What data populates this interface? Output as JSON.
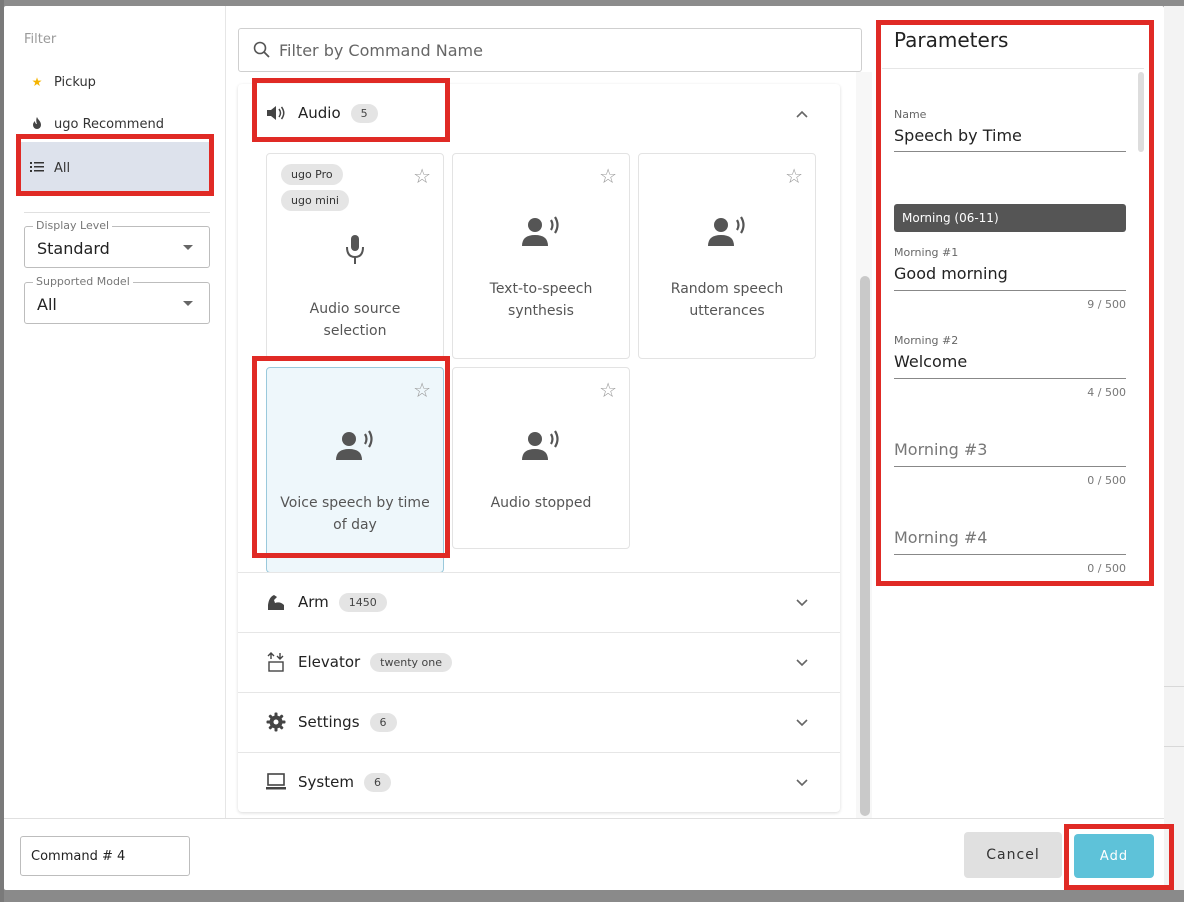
{
  "filter": {
    "title": "Filter",
    "items": [
      {
        "label": "Pickup",
        "icon": "star-icon"
      },
      {
        "label": "ugo Recommend",
        "icon": "flame-icon"
      },
      {
        "label": "All",
        "icon": "list-icon"
      }
    ],
    "display_level": {
      "label": "Display Level",
      "value": "Standard"
    },
    "supported_model": {
      "label": "Supported Model",
      "value": "All"
    }
  },
  "search": {
    "placeholder": "Filter by Command Name"
  },
  "groups": {
    "audio": {
      "label": "Audio",
      "count": "5"
    },
    "arm": {
      "label": "Arm",
      "count": "1450"
    },
    "elevator": {
      "label": "Elevator",
      "count": "twenty one"
    },
    "settings": {
      "label": "Settings",
      "count": "6"
    },
    "system": {
      "label": "System",
      "count": "6"
    }
  },
  "cards": [
    {
      "title": "Audio source selection",
      "chips": [
        "ugo Pro",
        "ugo mini"
      ],
      "icon": "microphone-icon"
    },
    {
      "title": "Text-to-speech synthesis",
      "icon": "voice-icon"
    },
    {
      "title": "Random speech utterances",
      "icon": "voice-icon"
    },
    {
      "title": "Voice speech by time of day",
      "icon": "voice-icon",
      "selected": true
    },
    {
      "title": "Audio stopped",
      "icon": "voice-icon"
    }
  ],
  "params": {
    "title": "Parameters",
    "name_label": "Name",
    "name_value": "Speech by Time",
    "section": "Morning (06-11)",
    "m1_label": "Morning #1",
    "m1_value": "Good morning",
    "m1_count": "9 / 500",
    "m2_label": "Morning #2",
    "m2_value": "Welcome",
    "m2_count": "4 / 500",
    "m3_placeholder": "Morning #3",
    "m3_count": "0 / 500",
    "m4_placeholder": "Morning #4",
    "m4_count": "0 / 500"
  },
  "footer": {
    "command_name": "Command # 4",
    "cancel_label": "Cancel",
    "add_label": "Add"
  },
  "colors": {
    "accent": "#5ec2d9",
    "highlight": "#e02a25",
    "active_filter": "#dde2ec"
  }
}
